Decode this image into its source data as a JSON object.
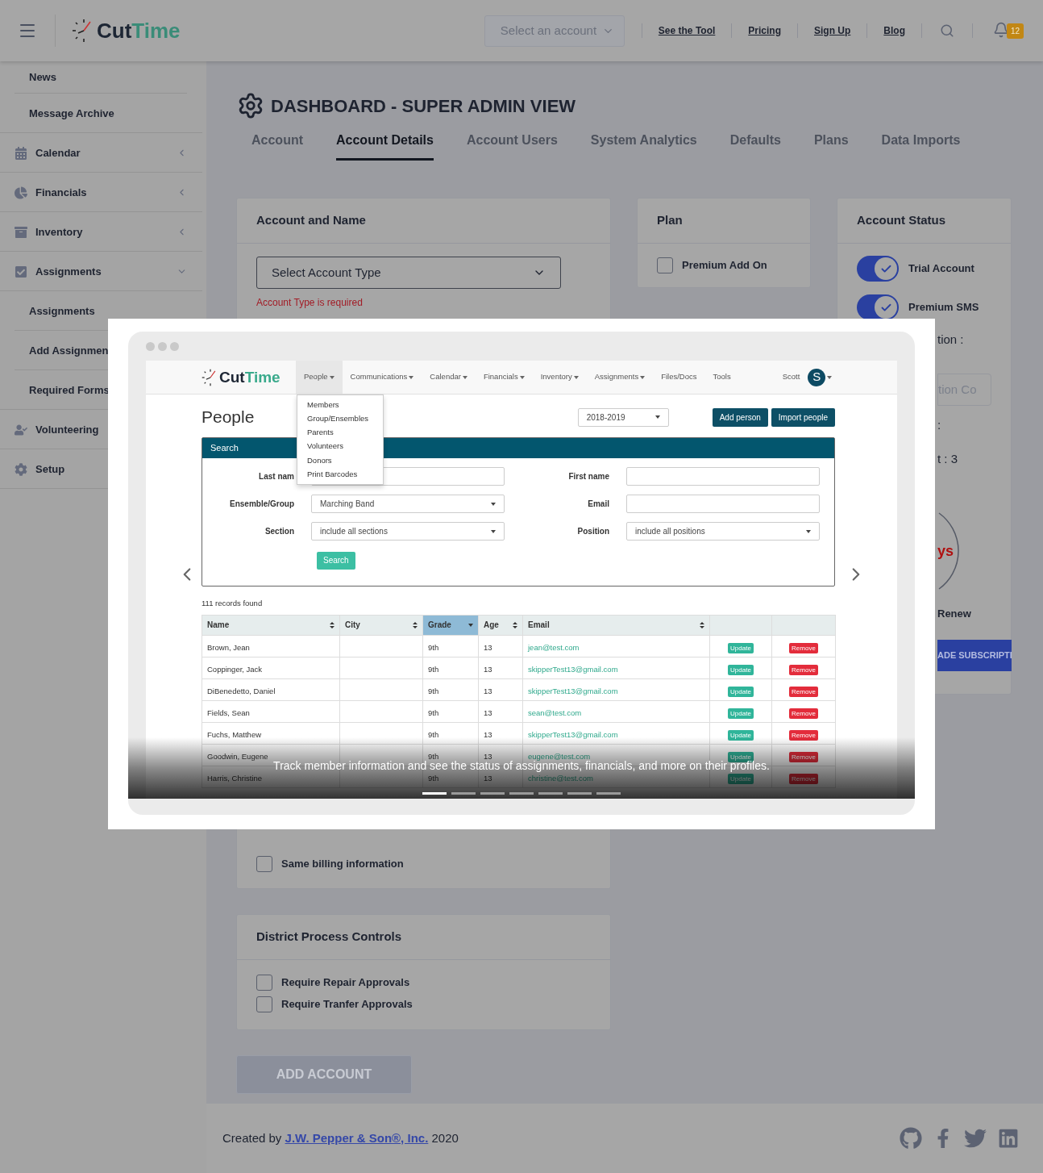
{
  "topbar": {
    "logo": [
      "Cut",
      "Time"
    ],
    "account_select": {
      "placeholder": "Select an account"
    },
    "links": [
      "See the Tool",
      "Pricing",
      "Sign Up",
      "Blog"
    ],
    "notifications": "12"
  },
  "sidebar": {
    "items": [
      {
        "kind": "sub",
        "label": "News"
      },
      {
        "kind": "sub",
        "label": "Message Archive"
      },
      {
        "kind": "group",
        "label": "Calendar",
        "expanded": false
      },
      {
        "kind": "group",
        "label": "Financials",
        "expanded": false
      },
      {
        "kind": "group",
        "label": "Inventory",
        "expanded": false
      },
      {
        "kind": "group",
        "label": "Assignments",
        "expanded": true
      },
      {
        "kind": "sub",
        "label": "Assignments"
      },
      {
        "kind": "sub",
        "label": "Add Assignmen"
      },
      {
        "kind": "sub",
        "label": "Required Forms"
      },
      {
        "kind": "link",
        "label": "Volunteering"
      },
      {
        "kind": "link",
        "label": "Setup"
      }
    ]
  },
  "page_title": "DASHBOARD - SUPER ADMIN VIEW",
  "tabs": [
    {
      "label": "Account",
      "selected": false
    },
    {
      "label": "Account Details",
      "selected": true
    },
    {
      "label": "Account Users",
      "selected": false
    },
    {
      "label": "System Analytics",
      "selected": false
    },
    {
      "label": "Defaults",
      "selected": false
    },
    {
      "label": "Plans",
      "selected": false
    },
    {
      "label": "Data Imports",
      "selected": false
    }
  ],
  "account_card": {
    "title": "Account and Name",
    "select": "Select Account Type",
    "error": "Account Type is required",
    "same_billing": {
      "label": "Same billing information",
      "checked": false
    }
  },
  "plan_card": {
    "title": "Plan",
    "options": [
      {
        "label": "Premium Add On",
        "checked": false
      }
    ]
  },
  "status_card": {
    "title": "Account Status",
    "toggles": [
      {
        "label": "Trial Account",
        "on": true
      },
      {
        "label": "Premium SMS",
        "on": true
      }
    ],
    "fragments": [
      {
        "kind": "label",
        "text": "tion :"
      },
      {
        "kind": "input",
        "placeholder": "tion Co"
      },
      {
        "kind": "label",
        "text": ":"
      },
      {
        "kind": "label",
        "text": "t : 3"
      },
      {
        "kind": "ring",
        "text": "ys"
      },
      {
        "kind": "caption",
        "text": "Renew"
      },
      {
        "kind": "button",
        "text": "ADE SUBSCRIPTI"
      }
    ]
  },
  "district_card": {
    "title": "District Process Controls",
    "options": [
      {
        "label": "Require Repair Approvals",
        "checked": false
      },
      {
        "label": "Require Tranfer Approvals",
        "checked": false
      }
    ]
  },
  "add_account": {
    "label": "ADD ACCOUNT",
    "disabled": true
  },
  "footer": {
    "prefix": "Created by",
    "link": "J.W. Pepper & Son®, Inc.",
    "suffix": "2020"
  },
  "modal": {
    "app_logo": [
      "Cut",
      "Time"
    ],
    "menu": [
      {
        "label": "People",
        "dropdown": true,
        "selected": true
      },
      {
        "label": "Communications",
        "dropdown": true,
        "selected": false
      },
      {
        "label": "Calendar",
        "dropdown": true,
        "selected": false
      },
      {
        "label": "Financials",
        "dropdown": true,
        "selected": false
      },
      {
        "label": "Inventory",
        "dropdown": true,
        "selected": false
      },
      {
        "label": "Assignments",
        "dropdown": true,
        "selected": false
      },
      {
        "label": "Files/Docs",
        "dropdown": false,
        "selected": false
      },
      {
        "label": "Tools",
        "dropdown": false,
        "selected": false
      }
    ],
    "user": "Scott",
    "avatar": "S",
    "dropdown_items": [
      "Members",
      "Group/Ensembles",
      "Parents",
      "Volunteers",
      "Donors",
      "Print Barcodes"
    ],
    "title": "People",
    "year": "2018-2019",
    "buttons": [
      "Add person",
      "Import people"
    ],
    "search": {
      "title": "Search",
      "fields": [
        {
          "kind": "input",
          "label": "Last nam"
        },
        {
          "kind": "input",
          "label": "First name"
        },
        {
          "kind": "select",
          "label": "Ensemble/Group",
          "value": "Marching Band"
        },
        {
          "kind": "input",
          "label": "Email"
        },
        {
          "kind": "select",
          "label": "Section",
          "value": "include all sections"
        },
        {
          "kind": "select",
          "label": "Position",
          "value": "include all positions"
        }
      ],
      "button": "Search"
    },
    "records": "111 records found",
    "columns": [
      {
        "label": "Name",
        "sortable": true,
        "selected": false
      },
      {
        "label": "City",
        "sortable": true,
        "selected": false
      },
      {
        "label": "Grade",
        "sortable": true,
        "selected": true
      },
      {
        "label": "Age",
        "sortable": true,
        "selected": false
      },
      {
        "label": "Email",
        "sortable": true,
        "selected": false
      }
    ],
    "rows": [
      {
        "cells": [
          "Brown, Jean",
          "",
          "9th",
          "13",
          "jean@test.com"
        ],
        "actions": [
          "Update",
          "Remove"
        ]
      },
      {
        "cells": [
          "Coppinger, Jack",
          "",
          "9th",
          "13",
          "skipperTest13@gmail.com"
        ],
        "actions": [
          "Update",
          "Remove"
        ]
      },
      {
        "cells": [
          "DiBenedetto, Daniel",
          "",
          "9th",
          "13",
          "skipperTest13@gmail.com"
        ],
        "actions": [
          "Update",
          "Remove"
        ]
      },
      {
        "cells": [
          "Fields, Sean",
          "",
          "9th",
          "13",
          "sean@test.com"
        ],
        "actions": [
          "Update",
          "Remove"
        ]
      },
      {
        "cells": [
          "Fuchs, Matthew",
          "",
          "9th",
          "13",
          "skipperTest13@gmail.com"
        ],
        "actions": [
          "Update",
          "Remove"
        ]
      },
      {
        "cells": [
          "Goodwin, Eugene",
          "",
          "9th",
          "13",
          "eugene@test.com"
        ],
        "actions": [
          "Update",
          "Remove"
        ]
      },
      {
        "cells": [
          "Harris, Christine",
          "",
          "9th",
          "13",
          "christine@test.com"
        ],
        "actions": [
          "Update",
          "Remove"
        ]
      }
    ],
    "caption": "Track member information and see the status of assignments, financials, and more on their profiles.",
    "slides": [
      {
        "selected": true
      },
      {
        "selected": false
      },
      {
        "selected": false
      },
      {
        "selected": false
      },
      {
        "selected": false
      },
      {
        "selected": false
      },
      {
        "selected": false
      }
    ]
  }
}
